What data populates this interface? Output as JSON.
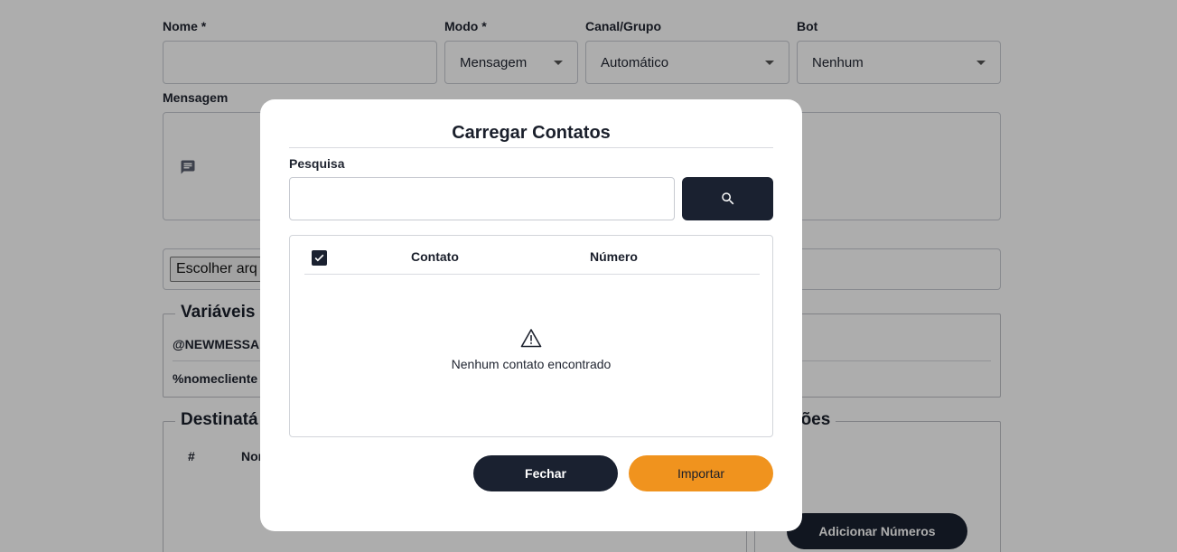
{
  "form": {
    "name_label": "Nome *",
    "mode_label": "Modo *",
    "mode_value": "Mensagem",
    "channel_label": "Canal/Grupo",
    "channel_value": "Automático",
    "bot_label": "Bot",
    "bot_value": "Nenhum",
    "message_label": "Mensagem",
    "file_button": "Escolher arq",
    "variables_legend": "Variáveis",
    "variables": [
      "@NEWMESSA",
      "%nomecliente"
    ],
    "recipients_legend": "Destinatá",
    "recipients_columns": [
      "#",
      "Nor"
    ],
    "options_legend": "ções",
    "add_numbers_button": "Adicionar Números"
  },
  "modal": {
    "title": "Carregar Contatos",
    "search_label": "Pesquisa",
    "search_value": "",
    "search_placeholder": "",
    "select_all_checked": true,
    "columns": [
      "Contato",
      "Número"
    ],
    "empty_message": "Nenhum contato encontrado",
    "close_button": "Fechar",
    "import_button": "Importar"
  },
  "colors": {
    "dark": "#1a2130",
    "accent": "#f0931e",
    "overlay": "rgba(0,0,0,0.32)"
  }
}
